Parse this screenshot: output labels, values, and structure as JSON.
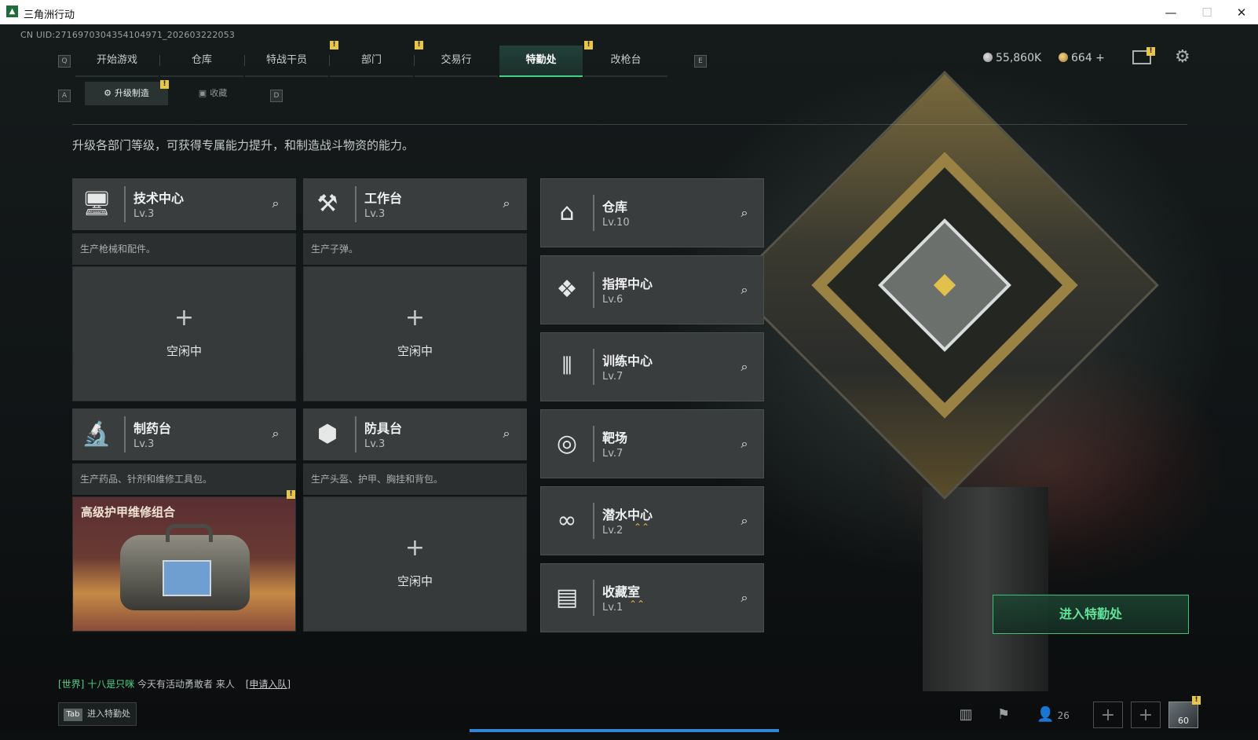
{
  "window": {
    "title": "三角洲行动",
    "minimize": "—",
    "maximize": "☐",
    "close": "✕"
  },
  "uid": "CN UID:2716970304354104971_202603222053",
  "keyhints": {
    "left": "Q",
    "right": "E",
    "sub_left": "A",
    "sub_right": "D"
  },
  "nav": {
    "items": [
      {
        "label": "开始游戏",
        "badge": ""
      },
      {
        "label": "仓库",
        "badge": ""
      },
      {
        "label": "特战干员",
        "badge": "!"
      },
      {
        "label": "部门",
        "badge": "!"
      },
      {
        "label": "交易行",
        "badge": ""
      },
      {
        "label": "特勤处",
        "badge": "!"
      },
      {
        "label": "改枪台",
        "badge": ""
      }
    ],
    "active": "特勤处"
  },
  "currency": {
    "coins": "55,860K",
    "premium": "664 +"
  },
  "icons": {
    "mail": "mail-icon",
    "settings": "gear-icon"
  },
  "subnav": {
    "items": [
      "升级制造",
      "收藏"
    ],
    "active": "升级制造",
    "badge": "!"
  },
  "description": "升级各部门等级，可获得专属能力提升，和制造战斗物资的能力。",
  "workshops": [
    {
      "name": "技术中心",
      "level": "Lv.3",
      "desc": "生产枪械和配件。",
      "state": "空闲中",
      "plus": "+",
      "icon": "monitor-icon"
    },
    {
      "name": "工作台",
      "level": "Lv.3",
      "desc": "生产子弹。",
      "state": "空闲中",
      "plus": "+",
      "icon": "hammer-wrench-icon"
    },
    {
      "name": "制药台",
      "level": "Lv.3",
      "desc": "生产药品、针剂和维修工具包。",
      "state": "",
      "product": "高级护甲维修组合",
      "badge": "!",
      "icon": "microscope-icon"
    },
    {
      "name": "防具台",
      "level": "Lv.3",
      "desc": "生产头盔、护甲、胸挂和背包。",
      "state": "空闲中",
      "plus": "+",
      "icon": "boxes-icon"
    }
  ],
  "facilities": [
    {
      "name": "仓库",
      "level": "Lv.10",
      "upgrade": "",
      "icon": "warehouse-icon"
    },
    {
      "name": "指挥中心",
      "level": "Lv.6",
      "upgrade": "",
      "icon": "command-icon"
    },
    {
      "name": "训练中心",
      "level": "Lv.7",
      "upgrade": "",
      "icon": "dumbbell-icon"
    },
    {
      "name": "靶场",
      "level": "Lv.7",
      "upgrade": "",
      "icon": "target-icon"
    },
    {
      "name": "潜水中心",
      "level": "Lv.2",
      "upgrade": "⌃⌃",
      "icon": "diving-mask-icon"
    },
    {
      "name": "收藏室",
      "level": "Lv.1",
      "upgrade": "⌃⌃",
      "icon": "collection-icon"
    }
  ],
  "enter_button": "进入特勤处",
  "chat": {
    "channel": "[世界]",
    "user": "十八是只咪",
    "message": "今天有活动勇敢者 来人",
    "action": "[申请入队]"
  },
  "tab_hint": {
    "key": "Tab",
    "label": "进入特勤处"
  },
  "bottom": {
    "friends_count": "26",
    "avatar_level": "60"
  },
  "colors": {
    "accent": "#3fd38a",
    "badge": "#e8c64a",
    "progress": "#2f86d6"
  }
}
